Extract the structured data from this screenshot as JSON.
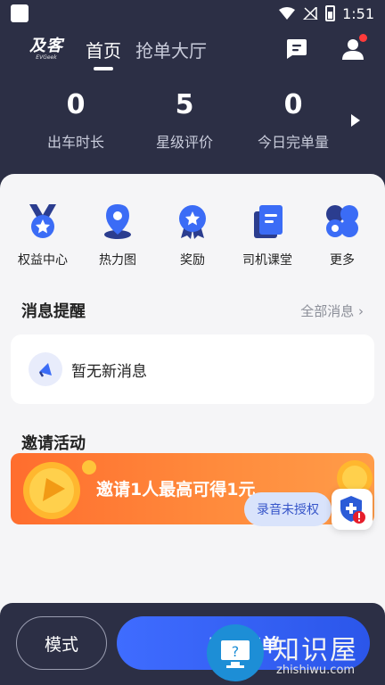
{
  "status_bar": {
    "time": "1:51"
  },
  "header": {
    "logo_main": "及客",
    "logo_sub": "EVGeek",
    "tabs": [
      {
        "label": "首页",
        "active": true
      },
      {
        "label": "抢单大厅",
        "active": false
      }
    ]
  },
  "stats": [
    {
      "value": "0",
      "label": "出车时长"
    },
    {
      "value": "5",
      "label": "星级评价"
    },
    {
      "value": "0",
      "label": "今日完单量"
    }
  ],
  "quick_menu": [
    {
      "label": "权益中心",
      "icon": "medal-icon"
    },
    {
      "label": "热力图",
      "icon": "map-pin-icon"
    },
    {
      "label": "奖励",
      "icon": "badge-star-icon"
    },
    {
      "label": "司机课堂",
      "icon": "book-icon"
    },
    {
      "label": "更多",
      "icon": "more-grid-icon"
    }
  ],
  "messages": {
    "title": "消息提醒",
    "more_label": "全部消息",
    "empty_text": "暂无新消息"
  },
  "invite": {
    "title": "邀请活动",
    "banner_text": "邀请1人最高可得1元"
  },
  "toast": {
    "text": "录音未授权"
  },
  "bottom": {
    "mode_label": "模式",
    "go_label": "出车接单"
  },
  "watermark": {
    "text": "知识屋",
    "sub": "zhishiwu.com"
  },
  "colors": {
    "header_bg": "#2c2f45",
    "accent_blue": "#3f6cff",
    "banner_orange": "#ff7a33",
    "notify_red": "#ff3b3b"
  }
}
